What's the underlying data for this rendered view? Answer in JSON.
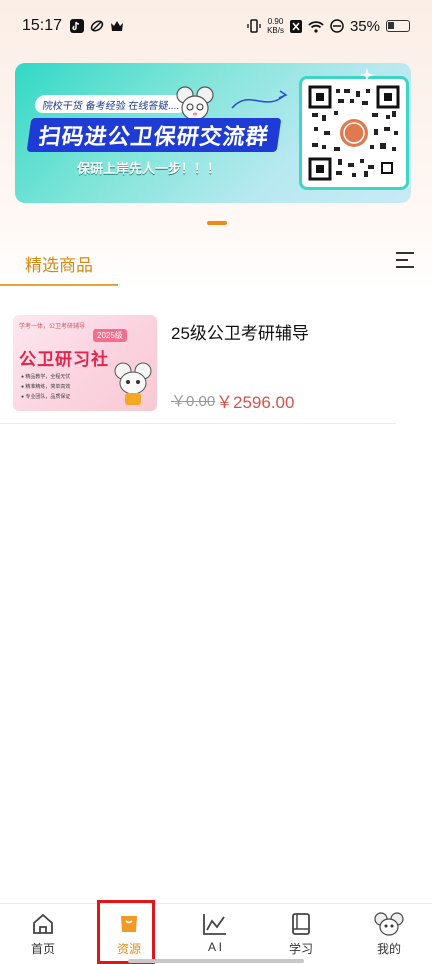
{
  "status_bar": {
    "time": "15:17",
    "speed_value": "0.90",
    "speed_unit": "KB/s",
    "battery": "35%"
  },
  "banner": {
    "tag": "院校干货 备考经验 在线答疑....",
    "title": "扫码进公卫保研交流群",
    "subtitle": "保研上岸先人一步！！！"
  },
  "tabs": {
    "active_label": "精选商品"
  },
  "products": [
    {
      "title": "25级公卫考研辅导",
      "price_original": "￥0.00",
      "price_current": "￥2596.00",
      "thumb": {
        "top_text": "学考一体，公卫考研辅导",
        "year": "2025级",
        "title": "公卫研习社",
        "line1": "● 精品教学，全程无忧",
        "line2": "● 精准精练，简单高效",
        "line3": "● 专业团队，品质保证"
      }
    }
  ],
  "bottom_nav": [
    {
      "label": "首页",
      "icon": "home-icon"
    },
    {
      "label": "资源",
      "icon": "bag-icon",
      "active": true
    },
    {
      "label": "A I",
      "icon": "chart-icon"
    },
    {
      "label": "学习",
      "icon": "book-icon"
    },
    {
      "label": "我的",
      "icon": "mascot-avatar-icon"
    }
  ],
  "colors": {
    "accent": "#f08a17",
    "price": "#d5534c",
    "highlight": "#e0161a"
  }
}
